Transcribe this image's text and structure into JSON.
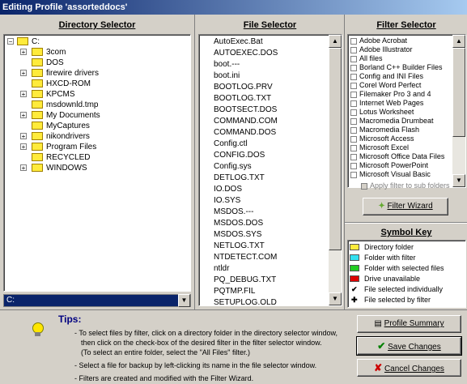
{
  "window": {
    "title": "Editing Profile 'assorteddocs'"
  },
  "directory": {
    "header": "Directory Selector",
    "root": "C:",
    "items": [
      {
        "label": "3com",
        "expandable": true
      },
      {
        "label": "DOS",
        "expandable": false
      },
      {
        "label": "firewire drivers",
        "expandable": true
      },
      {
        "label": "HXCD-ROM",
        "expandable": false
      },
      {
        "label": "KPCMS",
        "expandable": true
      },
      {
        "label": "msdownld.tmp",
        "expandable": false
      },
      {
        "label": "My Documents",
        "expandable": true
      },
      {
        "label": "MyCaptures",
        "expandable": false
      },
      {
        "label": "nikondrivers",
        "expandable": true
      },
      {
        "label": "Program Files",
        "expandable": true
      },
      {
        "label": "RECYCLED",
        "expandable": false
      },
      {
        "label": "WINDOWS",
        "expandable": true
      }
    ],
    "drive_value": "C:"
  },
  "files": {
    "header": "File Selector",
    "items": [
      "AutoExec.Bat",
      "AUTOEXEC.DOS",
      "boot.---",
      "boot.ini",
      "BOOTLOG.PRV",
      "BOOTLOG.TXT",
      "BOOTSECT.DOS",
      "COMMAND.COM",
      "COMMAND.DOS",
      "Config.ctl",
      "CONFIG.DOS",
      "Config.sys",
      "DETLOG.TXT",
      "IO.DOS",
      "IO.SYS",
      "MSDOS.---",
      "MSDOS.DOS",
      "MSDOS.SYS",
      "NETLOG.TXT",
      "NTDETECT.COM",
      "ntldr",
      "PQ_DEBUG.TXT",
      "PQTMP.FIL",
      "SETUPLOG.OLD"
    ]
  },
  "filters": {
    "header": "Filter Selector",
    "items": [
      "Adobe  Acrobat",
      "Adobe  Illustrator",
      "All files",
      "Borland C++ Builder Files",
      "Config and INI Files",
      "Corel Word Perfect",
      "Filemaker Pro 3 and 4",
      "Internet Web Pages",
      "Lotus Worksheet",
      "Macromedia Drumbeat",
      "Macromedia Flash",
      "Microsoft Access",
      "Microsoft Excel",
      "Microsoft Office Data Files",
      "Microsoft PowerPoint",
      "Microsoft Visual Basic"
    ],
    "apply_sub_label": "Apply filter to sub folders",
    "wizard_label": "Filter Wizard"
  },
  "symbol_key": {
    "header": "Symbol Key",
    "items": [
      {
        "label": "Directory folder",
        "icon": "folder-yellow-icon",
        "color": "#ffeb3b"
      },
      {
        "label": "Folder with filter",
        "icon": "folder-cyan-icon",
        "color": "#33e0f0"
      },
      {
        "label": "Folder with selected files",
        "icon": "folder-green-icon",
        "color": "#22cc22"
      },
      {
        "label": "Drive unavailable",
        "icon": "drive-red-icon",
        "color": "#dd0000"
      },
      {
        "label": "File selected individually",
        "icon": "checkmark-icon"
      },
      {
        "label": "File selected by filter",
        "icon": "plus-icon"
      }
    ]
  },
  "tips": {
    "title": "Tips:",
    "lines": [
      "- To select files by filter, click on a directory folder in the directory selector window,",
      "then click on the check-box of the desired filter in the filter selector window.",
      "(To select an entire folder, select the \"All Files\" filter.)",
      "- Select a file for backup by left-clicking its name in the file selector window.",
      "- Filters are created and modified with the Filter Wizard."
    ]
  },
  "buttons": {
    "profile_summary": "Profile Summary",
    "save_changes": "Save Changes",
    "cancel_changes": "Cancel Changes"
  }
}
